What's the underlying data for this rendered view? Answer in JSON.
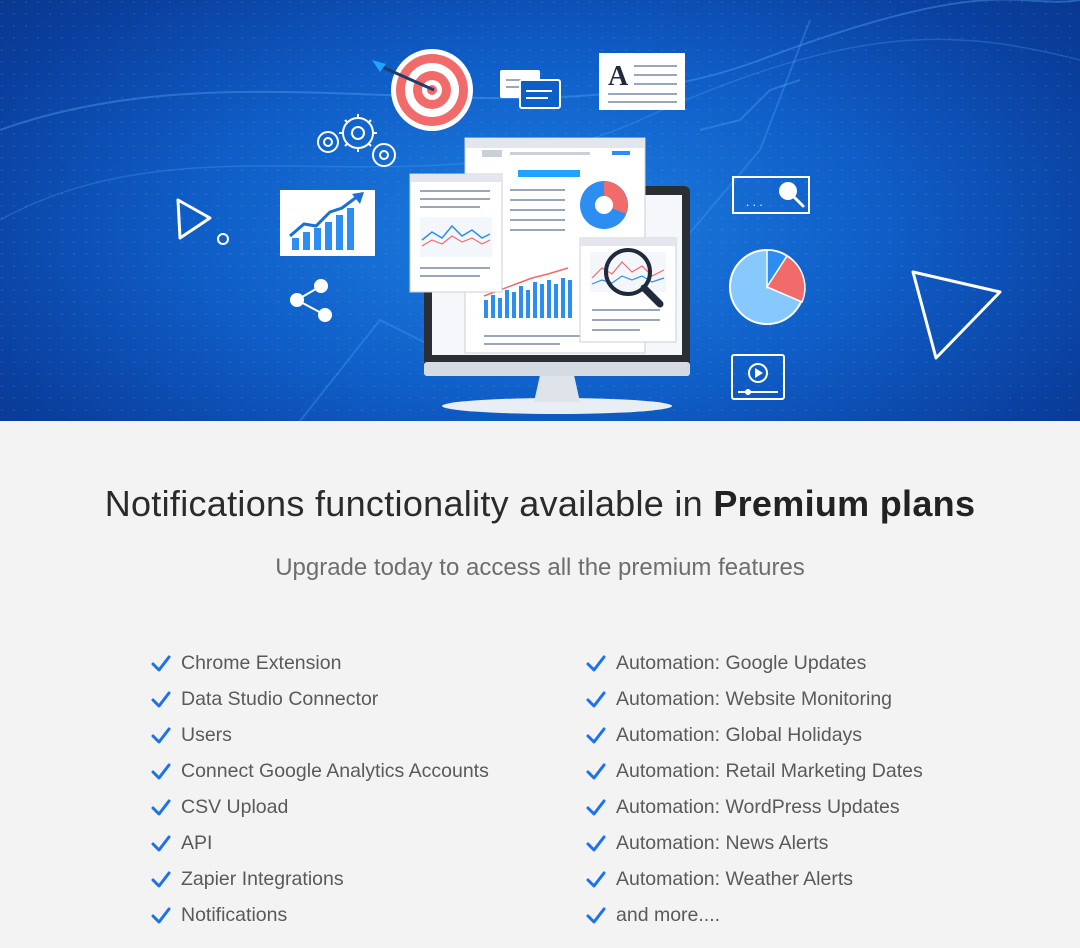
{
  "hero": {
    "illustration": "analytics-dashboard-illustration",
    "colors": {
      "bg_center": "#1e7fe0",
      "bg_edge": "#08358a",
      "accent_red": "#f26b6b",
      "accent_blue": "#2b8ef0"
    }
  },
  "heading": {
    "text_regular": "Notifications functionality available in ",
    "text_bold": "Premium plans"
  },
  "subheading": "Upgrade today to access all the premium features",
  "features": {
    "check_icon": "checkmark-icon",
    "check_color": "#1a73e8",
    "left": [
      "Chrome Extension",
      "Data Studio Connector",
      "Users",
      "Connect Google Analytics Accounts",
      "CSV Upload",
      "API",
      "Zapier Integrations",
      "Notifications"
    ],
    "right": [
      "Automation: Google Updates",
      "Automation: Website Monitoring",
      "Automation: Global Holidays",
      "Automation: Retail Marketing Dates",
      "Automation: WordPress Updates",
      "Automation: News Alerts",
      "Automation: Weather Alerts",
      "and more...."
    ]
  }
}
